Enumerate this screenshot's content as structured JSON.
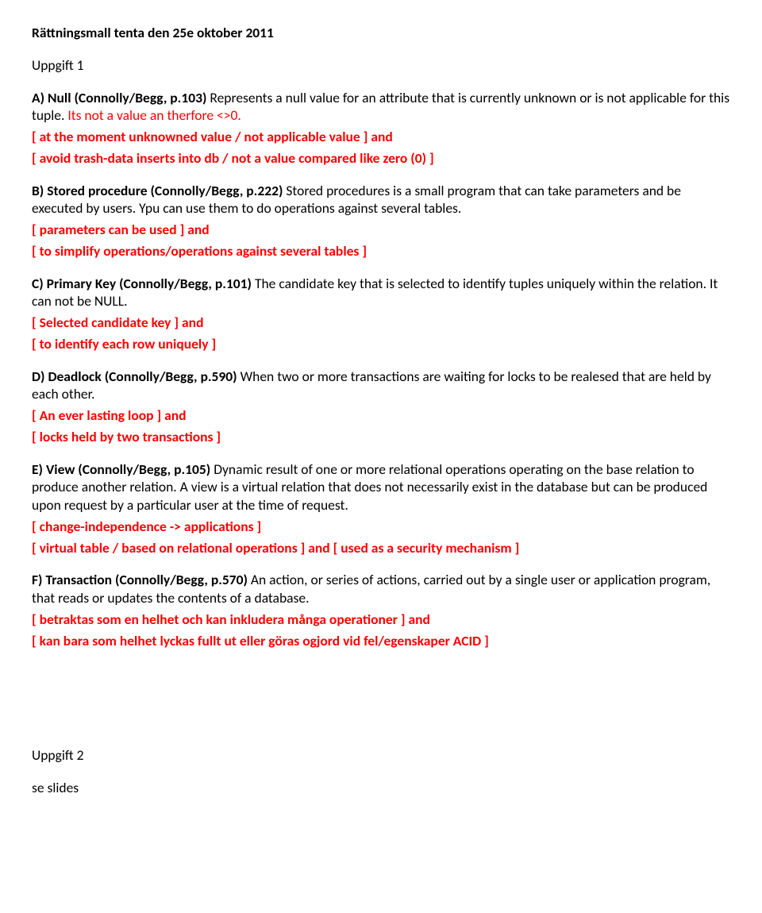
{
  "title": "Rättningsmall tenta den 25e oktober 2011",
  "uppgift1": "Uppgift 1",
  "A": {
    "lead_bold": "A) Null (Connolly/Begg, p.103)",
    "lead_rest": " Represents a null value for an attribute that is currently unknown or is not applicable for this tuple. ",
    "extra_red": "Its not a value an therfore <>0.",
    "r1": "[ at the moment unknowned value / not applicable value ]  and",
    "r2": "[ avoid trash-data inserts into db / not a value compared like zero (0) ]"
  },
  "B": {
    "lead_bold": "B) Stored procedure (Connolly/Begg, p.222)",
    "lead_rest": " Stored procedures is a small program that can take parameters and be executed by users. Ypu can use them to do operations against several tables.",
    "r1": "[ parameters can be used ] and",
    "r2": "[ to simplify operations/operations against several tables ]"
  },
  "C": {
    "lead_bold": "C) Primary Key (Connolly/Begg, p.101)",
    "lead_rest": " The candidate key that is selected to identify tuples uniquely within the relation. It can not be NULL.",
    "r1": "[ Selected candidate key ] and",
    "r2": "[ to identify each row uniquely ]"
  },
  "D": {
    "lead_bold": "D) Deadlock (Connolly/Begg, p.590)",
    "lead_rest": " When two or more transactions are waiting for locks to be realesed that are held by each other.",
    "r1": "[ An ever lasting loop ] and",
    "r2": "[ locks held by two transactions ]"
  },
  "E": {
    "lead_bold": "E) View (Connolly/Begg, p.105)",
    "lead_rest": " Dynamic result of one or more relational operations operating on the base relation to produce another relation. A view is a virtual relation that does not necessarily exist in the database but can be produced upon request by a particular user at the time of request.",
    "r1": "[ change-independence -> applications ]",
    "r2": "[ virtual table / based on relational operations ] and [ used as a security mechanism ]"
  },
  "F": {
    "lead_bold": "F) Transaction (Connolly/Begg, p.570)",
    "lead_rest": " An action, or series of actions, carried out by a single user or application program, that reads or updates the contents of a database.",
    "r1": "[ betraktas som en helhet och kan inkludera många operationer ] and",
    "r2": "[ kan bara som helhet lyckas fullt ut eller göras ogjord vid fel/egenskaper ACID ]"
  },
  "uppgift2": "Uppgift 2",
  "slides": "se slides"
}
